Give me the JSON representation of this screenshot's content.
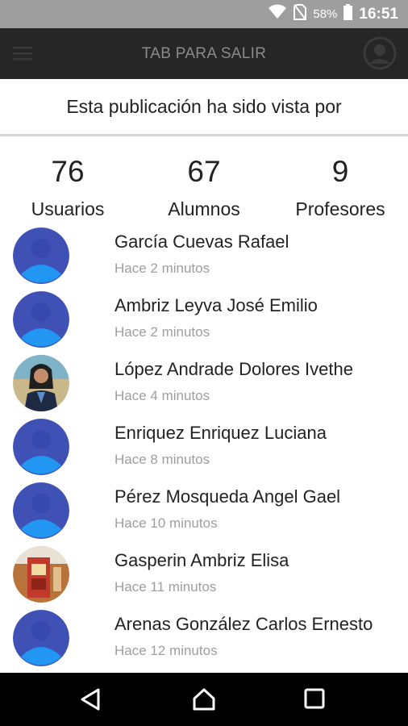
{
  "status_bar": {
    "battery_percent": "58%",
    "time": "16:51",
    "icons": [
      "wifi-icon",
      "no-sim-icon",
      "battery-icon"
    ]
  },
  "app_bar": {
    "title": "TAB PARA SALIR",
    "icons": [
      "menu-icon",
      "profile-icon"
    ]
  },
  "header": {
    "title": "Esta publicación ha sido vista por"
  },
  "stats": [
    {
      "count": "76",
      "label": "Usuarios"
    },
    {
      "count": "67",
      "label": "Alumnos"
    },
    {
      "count": "9",
      "label": "Profesores"
    }
  ],
  "viewers": [
    {
      "name": "García Cuevas Rafael",
      "time": "Hace 2 minutos",
      "avatar": "default-avatar"
    },
    {
      "name": "Ambriz Leyva José Emilio",
      "time": "Hace 2 minutos",
      "avatar": "default-avatar"
    },
    {
      "name": "López Andrade Dolores Ivethe",
      "time": "Hace 4 minutos",
      "avatar": "photo-avatar"
    },
    {
      "name": "Enriquez Enriquez Luciana",
      "time": "Hace 8 minutos",
      "avatar": "default-avatar"
    },
    {
      "name": "Pérez Mosqueda Angel Gael",
      "time": "Hace 10 minutos",
      "avatar": "default-avatar"
    },
    {
      "name": "Gasperin Ambriz Elisa",
      "time": "Hace 11 minutos",
      "avatar": "photo-avatar"
    },
    {
      "name": "Arenas González Carlos Ernesto",
      "time": "Hace 12 minutos",
      "avatar": "default-avatar"
    }
  ],
  "nav_bar": {
    "icons": [
      "back-icon",
      "home-icon",
      "recents-icon"
    ]
  },
  "colors": {
    "status_bar": "#9e9e9e",
    "app_bar": "#262626",
    "avatar_blue": "#3f51b5",
    "avatar_light": "#2196f3",
    "secondary_text": "#9e9e9e"
  }
}
